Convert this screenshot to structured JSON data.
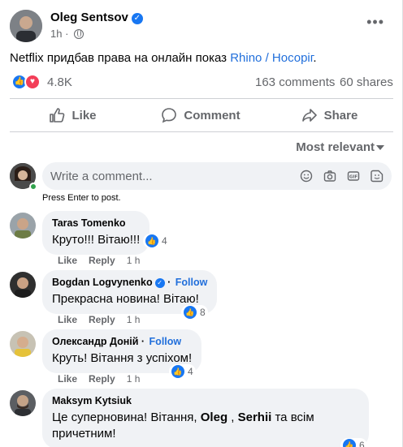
{
  "post": {
    "author": "Oleg Sentsov",
    "time": "1h",
    "more_label": "•••",
    "text_prefix": "Netflix придбав права на онлайн показ ",
    "link_text": "Rhino / Носоріг",
    "text_suffix": ".",
    "reaction_count": "4.8K",
    "comments_count": "163 comments",
    "shares_count": "60 shares"
  },
  "actions": {
    "like": "Like",
    "comment": "Comment",
    "share": "Share"
  },
  "sort": {
    "label": "Most relevant"
  },
  "composer": {
    "placeholder": "Write a comment...",
    "hint": "Press Enter to post."
  },
  "comments": [
    {
      "author": "Taras Tomenko",
      "text": "Круто!!! Вітаю!!!",
      "reacts": "4",
      "like": "Like",
      "reply": "Reply",
      "time": "1 h"
    },
    {
      "author": "Bogdan Logvynenko",
      "follow": "Follow",
      "text": "Прекрасна новина! Вітаю!",
      "reacts": "8",
      "like": "Like",
      "reply": "Reply",
      "time": "1 h"
    },
    {
      "author": "Олександр Доній",
      "follow": "Follow",
      "text": "Круть! Вітання з успіхом!",
      "reacts": "4",
      "like": "Like",
      "reply": "Reply",
      "time": "1 h"
    },
    {
      "author": "Maksym Kytsiuk",
      "text_a": "Це суперновина! Вітання, ",
      "mention_1": "Oleg",
      "text_b": " , ",
      "mention_2": "Serhii",
      "text_c": " та всім причетним!",
      "reacts": "6"
    }
  ],
  "colors": {
    "accent": "#1877f2",
    "love": "#f33e58",
    "link": "#216fdb",
    "muted": "#65676b",
    "bubble": "#f0f2f5",
    "online": "#31a24c"
  },
  "icons": [
    "verified-icon",
    "globe-icon",
    "more-icon",
    "like-icon",
    "comment-icon",
    "share-icon",
    "chevron-down-icon",
    "emoji-icon",
    "camera-icon",
    "gif-icon",
    "sticker-icon"
  ]
}
